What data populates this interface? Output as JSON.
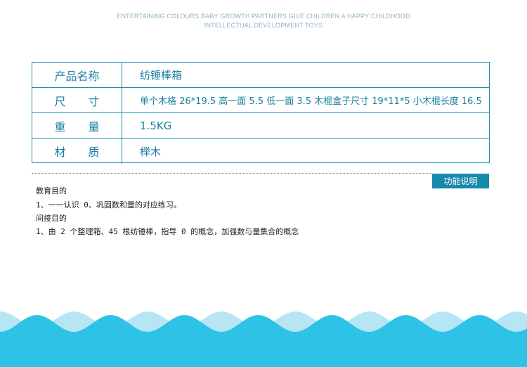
{
  "header": {
    "tagline_1": "ENTERTAINING COLOURS BABY GROWTH PARTNERS GIVE CHILDREN A HAPPY CHILDHOOD",
    "tagline_2": "INTELLECTUAL DEVELOPMENT TOYS"
  },
  "specs": {
    "rows": [
      {
        "label": "产品名称",
        "value": "纺锤棒箱"
      },
      {
        "label": "尺　　寸",
        "value": "单个木格 26*19.5  高一面 5.5 低一面 3.5  木棍盒子尺寸 19*11*5  小木棍长度 16.5"
      },
      {
        "label": "重　　量",
        "value": "1.5KG"
      },
      {
        "label": "材　　质",
        "value": "榉木"
      }
    ]
  },
  "function": {
    "badge": "功能说明",
    "lines": [
      "教育目的",
      "1、一一认识 0、巩固数和量的对应练习。",
      "间接目的",
      "1、由 2 个整理箱、45 根纺锤棒，指导 0 的概念，加强数与量集合的概念"
    ]
  },
  "colors": {
    "border": "#1a8fb0",
    "text_accent": "#1a7fa0",
    "badge_bg": "#1789aa",
    "wave_light": "#b6e6f4",
    "wave_main": "#2ec3e6"
  }
}
